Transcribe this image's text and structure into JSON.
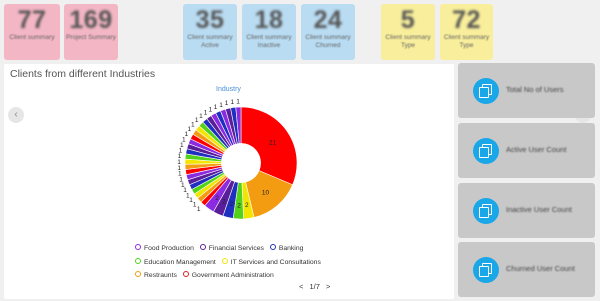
{
  "stats": [
    {
      "value": "77",
      "label": "Client summary"
    },
    {
      "value": "169",
      "label": "Project Summary"
    },
    {
      "value": "35",
      "label": "Client summary Active"
    },
    {
      "value": "18",
      "label": "Client summary Inactive"
    },
    {
      "value": "24",
      "label": "Client summary Churned"
    },
    {
      "value": "5",
      "label": "Client summary Type"
    },
    {
      "value": "72",
      "label": "Client summary Type"
    }
  ],
  "panel": {
    "title": "Clients from different Industries",
    "chart_title": "Industry",
    "pager_prev": "<",
    "pager_text": "1/7",
    "pager_next": ">"
  },
  "legend": [
    {
      "label": "Food Production",
      "color": "#8a2be2"
    },
    {
      "label": "Financial Services",
      "color": "#5b1e9b"
    },
    {
      "label": "Banking",
      "color": "#1f2fbf"
    },
    {
      "label": "Education Management",
      "color": "#53d21a"
    },
    {
      "label": "IT Services and Consultations",
      "color": "#f2e600"
    },
    {
      "label": "Restraunts",
      "color": "#f39c12"
    },
    {
      "label": "Government Administration",
      "color": "#e02020"
    }
  ],
  "chart_data": {
    "type": "pie",
    "inner_radius_ratio": 0.35,
    "slices": [
      {
        "label": "Government Administration",
        "value": 21,
        "color": "#ff0000"
      },
      {
        "label": "Restraunts",
        "value": 10,
        "color": "#f39c12"
      },
      {
        "label": "IT Services and Consultations",
        "value": 2,
        "color": "#f2e600"
      },
      {
        "label": "Education Management",
        "value": 2,
        "color": "#53d21a"
      },
      {
        "label": "Banking",
        "value": 2,
        "color": "#1f2fbf"
      },
      {
        "label": "Financial Services",
        "value": 2,
        "color": "#5b1e9b"
      },
      {
        "label": "Food Production",
        "value": 2,
        "color": "#8a2be2"
      },
      {
        "label": "",
        "value": 1,
        "color": "#ff0000"
      },
      {
        "label": "",
        "value": 1,
        "color": "#f39c12"
      },
      {
        "label": "",
        "value": 1,
        "color": "#f2e600"
      },
      {
        "label": "",
        "value": 1,
        "color": "#53d21a"
      },
      {
        "label": "",
        "value": 1,
        "color": "#1f2fbf"
      },
      {
        "label": "",
        "value": 1,
        "color": "#5b1e9b"
      },
      {
        "label": "",
        "value": 1,
        "color": "#8a2be2"
      },
      {
        "label": "",
        "value": 1,
        "color": "#ff0000"
      },
      {
        "label": "",
        "value": 1,
        "color": "#f39c12"
      },
      {
        "label": "",
        "value": 1,
        "color": "#f2e600"
      },
      {
        "label": "",
        "value": 1,
        "color": "#53d21a"
      },
      {
        "label": "",
        "value": 1,
        "color": "#1f2fbf"
      },
      {
        "label": "",
        "value": 1,
        "color": "#5b1e9b"
      },
      {
        "label": "",
        "value": 1,
        "color": "#8a2be2"
      },
      {
        "label": "",
        "value": 1,
        "color": "#ff0000"
      },
      {
        "label": "",
        "value": 1,
        "color": "#f39c12"
      },
      {
        "label": "",
        "value": 1,
        "color": "#f2e600"
      },
      {
        "label": "",
        "value": 1,
        "color": "#53d21a"
      },
      {
        "label": "",
        "value": 1,
        "color": "#1f2fbf"
      },
      {
        "label": "",
        "value": 1,
        "color": "#5b1e9b"
      },
      {
        "label": "",
        "value": 1,
        "color": "#8a2be2"
      },
      {
        "label": "",
        "value": 1,
        "color": "#1f2fbf"
      },
      {
        "label": "",
        "value": 1,
        "color": "#8a2be2"
      },
      {
        "label": "",
        "value": 1,
        "color": "#5b1e9b"
      },
      {
        "label": "",
        "value": 1,
        "color": "#1f2fbf"
      },
      {
        "label": "",
        "value": 1,
        "color": "#8a2be2"
      }
    ]
  },
  "side_cards": [
    {
      "label": "Total No of Users",
      "icon": "copy-icon"
    },
    {
      "label": "Active User Count",
      "icon": "copy-icon"
    },
    {
      "label": "Inactive User Count",
      "icon": "copy-icon"
    },
    {
      "label": "Churned User Count",
      "icon": "copy-icon"
    }
  ],
  "nav": {
    "prev": "‹",
    "next": "›"
  }
}
